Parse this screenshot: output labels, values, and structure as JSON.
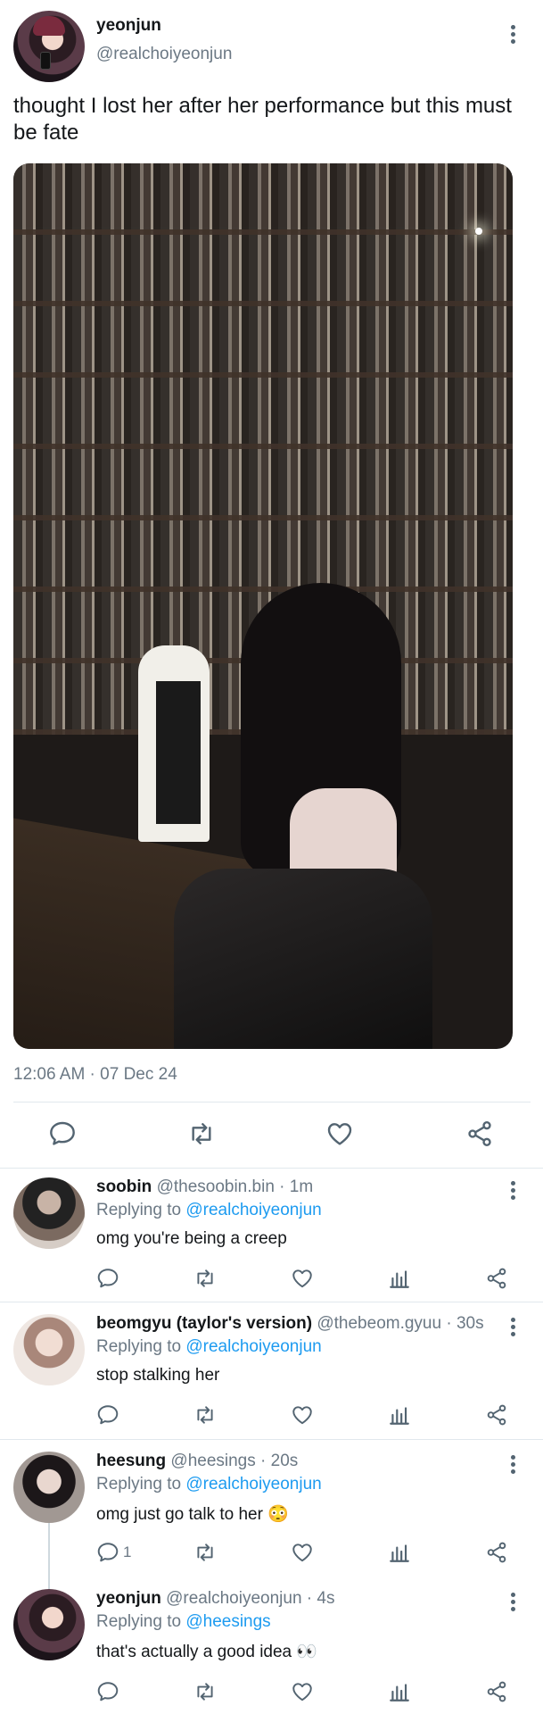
{
  "main_tweet": {
    "display_name": "yeonjun",
    "handle": "@realchoiyeonjun",
    "text": "thought I lost her after her performance but this must be fate",
    "timestamp": "12:06 AM · 07 Dec 24"
  },
  "replies": [
    {
      "display_name": "soobin",
      "handle_time": "@thesoobin.bin · 1m",
      "replying_prefix": "Replying to ",
      "replying_to": "@realchoiyeonjun",
      "text": "omg you're being a creep",
      "reply_count": ""
    },
    {
      "display_name": "beomgyu (taylor's version)",
      "handle_time": "@thebeom.gyuu · 30s",
      "replying_prefix": "Replying to ",
      "replying_to": "@realchoiyeonjun",
      "text": "stop stalking her",
      "reply_count": ""
    },
    {
      "display_name": "heesung",
      "handle_time": "@heesings · 20s",
      "replying_prefix": "Replying to ",
      "replying_to": "@realchoiyeonjun",
      "text": "omg just go talk to her 😳",
      "reply_count": "1"
    },
    {
      "display_name": "yeonjun",
      "handle_time": "@realchoiyeonjun · 4s",
      "replying_prefix": "Replying to ",
      "replying_to": "@heesings",
      "text": "that's actually a good idea 👀",
      "reply_count": ""
    }
  ],
  "icons": {
    "reply": "reply-icon",
    "retweet": "retweet-icon",
    "like": "heart-icon",
    "analytics": "analytics-icon",
    "share": "share-icon",
    "more": "more-vertical-icon"
  },
  "colors": {
    "text": "#14171a",
    "secondary": "#6b7884",
    "link": "#1d9bf0",
    "divider": "#e1e8ed"
  }
}
